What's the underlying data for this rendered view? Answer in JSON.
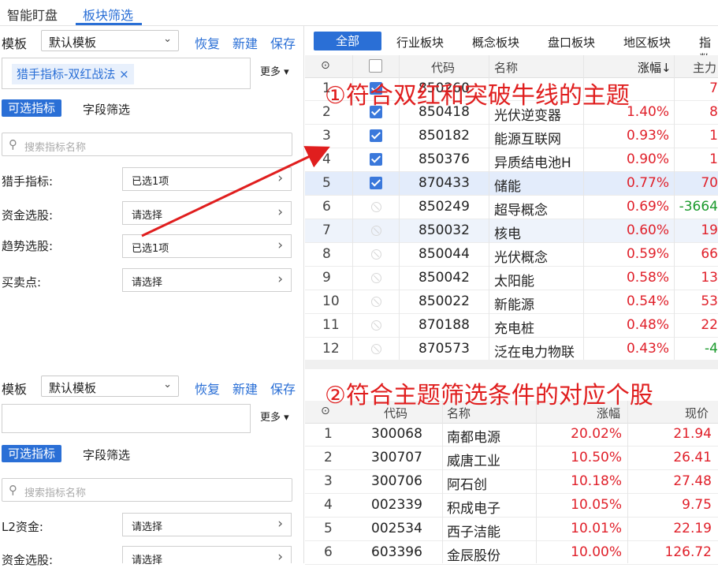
{
  "top_tabs": [
    "智能盯盘",
    "板块筛选"
  ],
  "upper_panel": {
    "template_label": "模板",
    "template_value": "默认模板",
    "actions": [
      "恢复",
      "新建",
      "保存"
    ],
    "tag": "猎手指标-双红战法 ×",
    "more": "更多 ▾",
    "subtabs": [
      "可选指标",
      "字段筛选"
    ],
    "search_placeholder": "搜索指标名称",
    "filters": [
      {
        "label": "猎手指标:",
        "value": "已选1项"
      },
      {
        "label": "资金选股:",
        "value": "请选择"
      },
      {
        "label": "趋势选股:",
        "value": "已选1项"
      },
      {
        "label": "买卖点:",
        "value": "请选择"
      }
    ]
  },
  "lower_panel": {
    "template_label": "模板",
    "template_value": "默认模板",
    "actions": [
      "恢复",
      "新建",
      "保存"
    ],
    "more": "更多 ▾",
    "subtabs": [
      "可选指标",
      "字段筛选"
    ],
    "search_placeholder": "搜索指标名称",
    "filters": [
      {
        "label": "L2资金:",
        "value": "请选择"
      },
      {
        "label": "资金选股:",
        "value": "请选择"
      }
    ]
  },
  "category_tabs": [
    "全部",
    "行业板块",
    "概念板块",
    "盘口板块",
    "地区板块",
    "指数"
  ],
  "sector_table": {
    "headers": [
      "代码",
      "名称",
      "涨幅↓",
      "主力"
    ],
    "rows": [
      {
        "idx": "1",
        "code": "850260",
        "name": "",
        "chg": "",
        "main": "7",
        "main_color": "red",
        "check": "on"
      },
      {
        "idx": "2",
        "code": "850418",
        "name": "光伏逆变器",
        "chg": "1.40%",
        "main": "8",
        "main_color": "red",
        "check": "on"
      },
      {
        "idx": "3",
        "code": "850182",
        "name": "能源互联网",
        "chg": "0.93%",
        "main": "1",
        "main_color": "red",
        "check": "on"
      },
      {
        "idx": "4",
        "code": "850376",
        "name": "异质结电池H",
        "chg": "0.90%",
        "main": "1",
        "main_color": "red",
        "check": "on"
      },
      {
        "idx": "5",
        "code": "870433",
        "name": "储能",
        "chg": "0.77%",
        "main": "70",
        "main_color": "red",
        "check": "on"
      },
      {
        "idx": "6",
        "code": "850249",
        "name": "超导概念",
        "chg": "0.69%",
        "main": "-3664",
        "main_color": "green",
        "check": "dis"
      },
      {
        "idx": "7",
        "code": "850032",
        "name": "核电",
        "chg": "0.60%",
        "main": "19",
        "main_color": "red",
        "check": "dis"
      },
      {
        "idx": "8",
        "code": "850044",
        "name": "光伏概念",
        "chg": "0.59%",
        "main": "66",
        "main_color": "red",
        "check": "dis"
      },
      {
        "idx": "9",
        "code": "850042",
        "name": "太阳能",
        "chg": "0.58%",
        "main": "13",
        "main_color": "red",
        "check": "dis"
      },
      {
        "idx": "10",
        "code": "850022",
        "name": "新能源",
        "chg": "0.54%",
        "main": "53",
        "main_color": "red",
        "check": "dis"
      },
      {
        "idx": "11",
        "code": "870188",
        "name": "充电桩",
        "chg": "0.48%",
        "main": "22",
        "main_color": "red",
        "check": "dis"
      },
      {
        "idx": "12",
        "code": "870573",
        "name": "泛在电力物联",
        "chg": "0.43%",
        "main": "-4",
        "main_color": "green",
        "check": "dis"
      }
    ]
  },
  "stock_table": {
    "headers": [
      "代码",
      "名称",
      "涨幅",
      "现价"
    ],
    "rows": [
      {
        "idx": "1",
        "code": "300068",
        "name": "南都电源",
        "chg": "20.02%",
        "price": "21.94"
      },
      {
        "idx": "2",
        "code": "300707",
        "name": "威唐工业",
        "chg": "10.50%",
        "price": "26.41"
      },
      {
        "idx": "3",
        "code": "300706",
        "name": "阿石创",
        "chg": "10.18%",
        "price": "27.48"
      },
      {
        "idx": "4",
        "code": "002339",
        "name": "积成电子",
        "chg": "10.05%",
        "price": "9.75"
      },
      {
        "idx": "5",
        "code": "002534",
        "name": "西子洁能",
        "chg": "10.01%",
        "price": "22.19"
      },
      {
        "idx": "6",
        "code": "603396",
        "name": "金辰股份",
        "chg": "10.00%",
        "price": "126.72"
      }
    ]
  },
  "annotations": {
    "one": "①符合双红和突破牛线的主题",
    "two": "②符合主题筛选条件的对应个股"
  },
  "colors": {
    "accent": "#2a6fd6",
    "up": "#e0202a",
    "down": "#1a9a2c",
    "annotation": "#e01e1e"
  }
}
